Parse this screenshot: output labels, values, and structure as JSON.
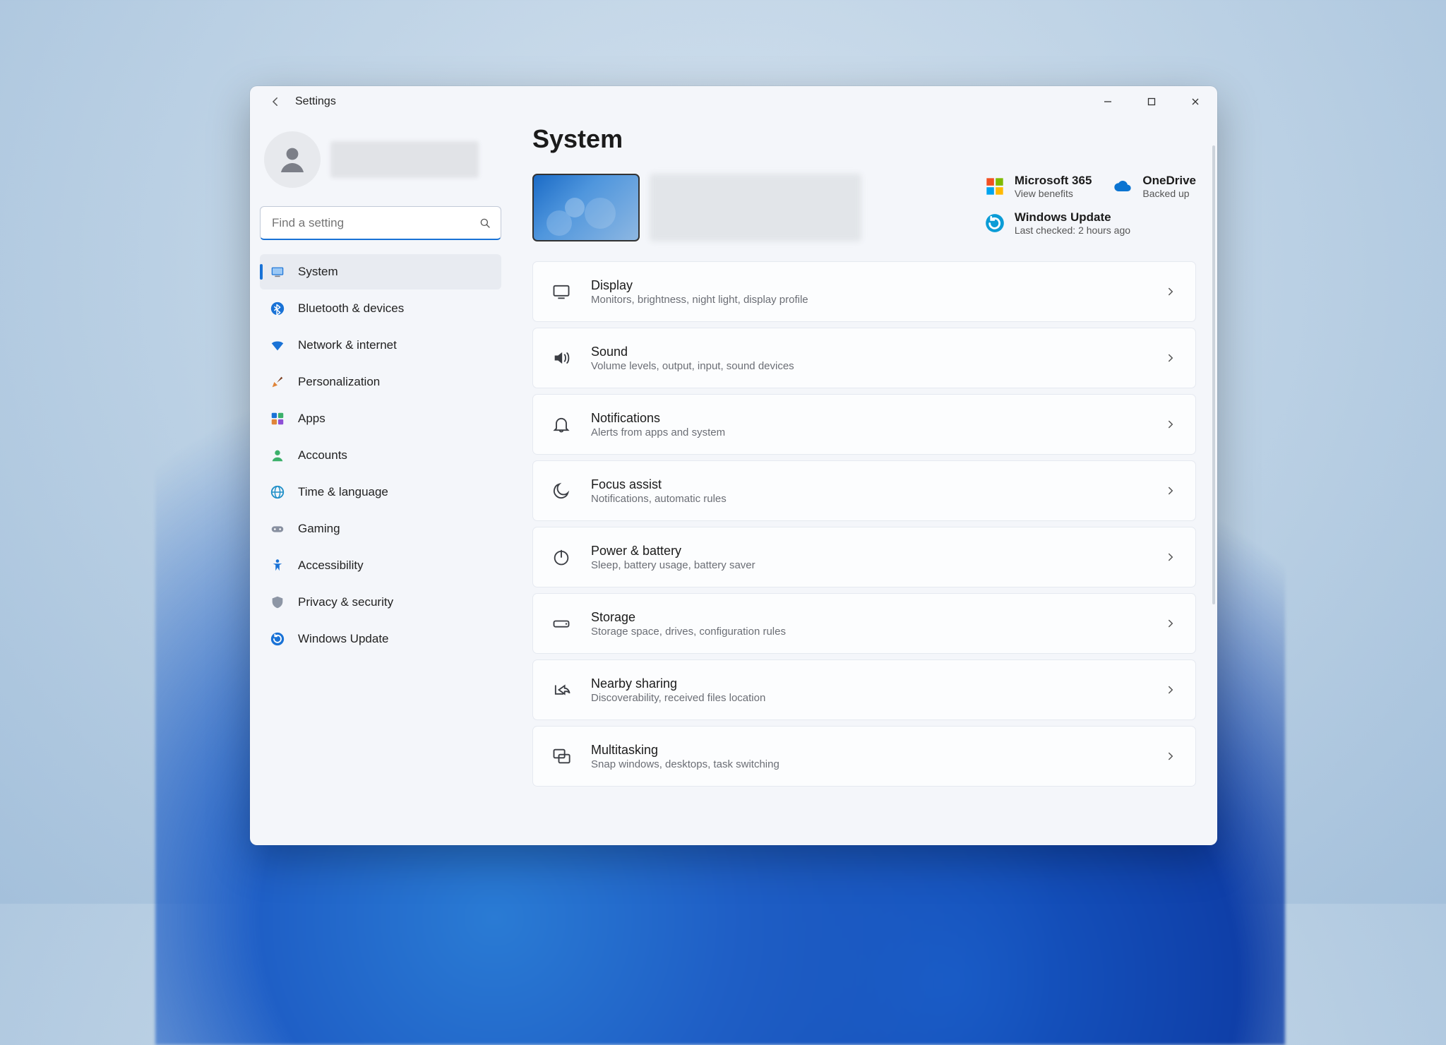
{
  "window": {
    "title": "Settings"
  },
  "search": {
    "placeholder": "Find a setting"
  },
  "page": {
    "title": "System"
  },
  "sidebar": {
    "items": [
      {
        "label": "System"
      },
      {
        "label": "Bluetooth & devices"
      },
      {
        "label": "Network & internet"
      },
      {
        "label": "Personalization"
      },
      {
        "label": "Apps"
      },
      {
        "label": "Accounts"
      },
      {
        "label": "Time & language"
      },
      {
        "label": "Gaming"
      },
      {
        "label": "Accessibility"
      },
      {
        "label": "Privacy & security"
      },
      {
        "label": "Windows Update"
      }
    ]
  },
  "status": {
    "ms365": {
      "title": "Microsoft 365",
      "sub": "View benefits"
    },
    "onedrive": {
      "title": "OneDrive",
      "sub": "Backed up"
    },
    "update": {
      "title": "Windows Update",
      "sub": "Last checked: 2 hours ago"
    }
  },
  "cards": [
    {
      "title": "Display",
      "sub": "Monitors, brightness, night light, display profile"
    },
    {
      "title": "Sound",
      "sub": "Volume levels, output, input, sound devices"
    },
    {
      "title": "Notifications",
      "sub": "Alerts from apps and system"
    },
    {
      "title": "Focus assist",
      "sub": "Notifications, automatic rules"
    },
    {
      "title": "Power & battery",
      "sub": "Sleep, battery usage, battery saver"
    },
    {
      "title": "Storage",
      "sub": "Storage space, drives, configuration rules"
    },
    {
      "title": "Nearby sharing",
      "sub": "Discoverability, received files location"
    },
    {
      "title": "Multitasking",
      "sub": "Snap windows, desktops, task switching"
    }
  ]
}
